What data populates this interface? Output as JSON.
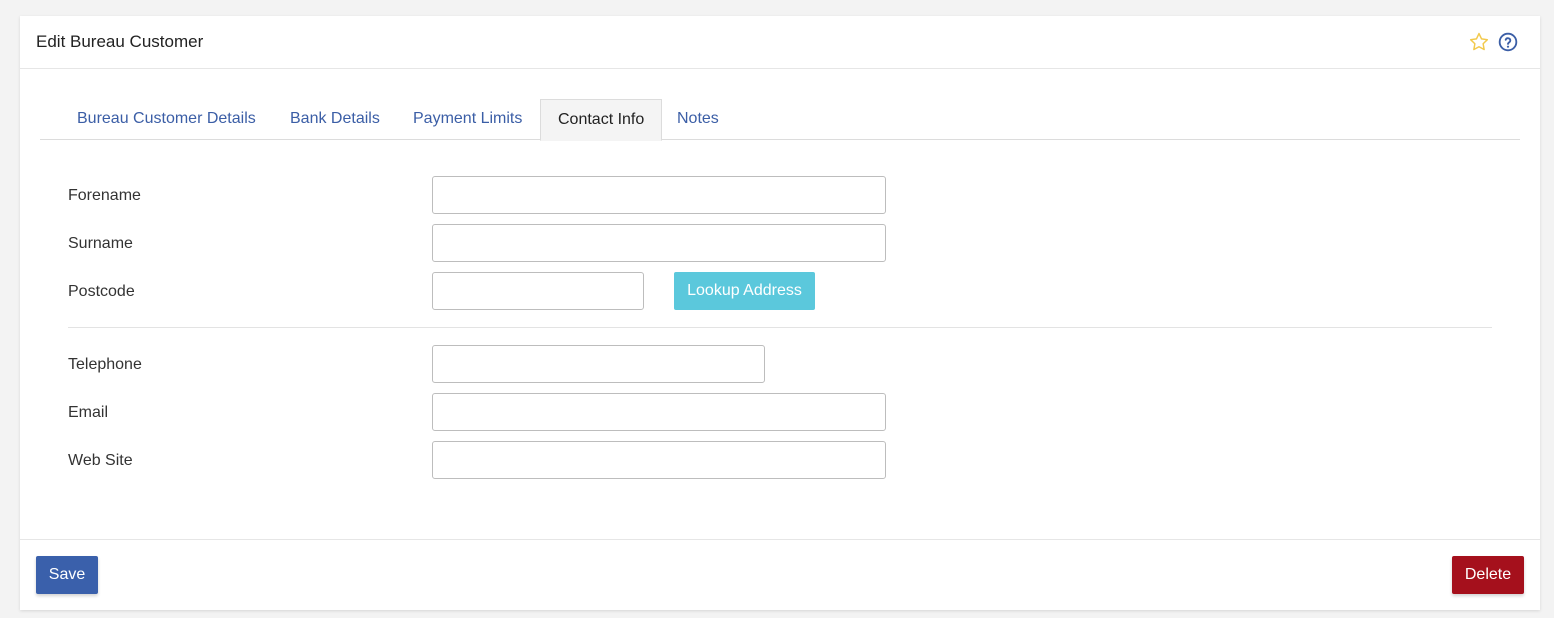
{
  "page": {
    "title": "Edit Bureau Customer"
  },
  "icons": {
    "favorite": "star-outline-icon",
    "help": "question-circle-icon",
    "favorite_color": "#f2c94c",
    "help_color": "#3b5ea6"
  },
  "tabs": [
    {
      "label": "Bureau Customer Details",
      "active": false
    },
    {
      "label": "Bank Details",
      "active": false
    },
    {
      "label": "Payment Limits",
      "active": false
    },
    {
      "label": "Contact Info",
      "active": true
    },
    {
      "label": "Notes",
      "active": false
    }
  ],
  "form": {
    "forename": {
      "label": "Forename",
      "value": "",
      "placeholder": ""
    },
    "surname": {
      "label": "Surname",
      "value": "",
      "placeholder": ""
    },
    "postcode": {
      "label": "Postcode",
      "value": "",
      "placeholder": ""
    },
    "lookup_label": "Lookup Address",
    "telephone": {
      "label": "Telephone",
      "value": "",
      "placeholder": ""
    },
    "email": {
      "label": "Email",
      "value": "",
      "placeholder": ""
    },
    "website": {
      "label": "Web Site",
      "value": "",
      "placeholder": ""
    }
  },
  "footer": {
    "save_label": "Save",
    "delete_label": "Delete"
  },
  "colors": {
    "primary": "#3a60ab",
    "info": "#5bc8dc",
    "danger": "#a5101c",
    "link": "#3b5ea6"
  }
}
